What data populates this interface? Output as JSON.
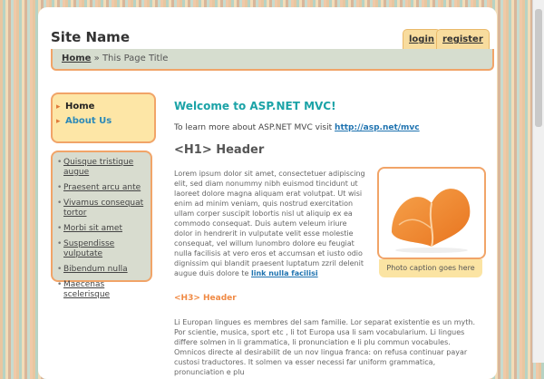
{
  "header": {
    "site_name": "Site Name",
    "login_label": "login",
    "register_label": "register"
  },
  "breadcrumb": {
    "home": "Home",
    "separator": "»",
    "current": "This Page Title"
  },
  "nav": {
    "items": [
      {
        "label": "Home"
      },
      {
        "label": "About Us"
      }
    ]
  },
  "sidebar_links": [
    "Quisque tristique augue",
    "Praesent arcu ante",
    "Vivamus consequat tortor",
    "Morbi sit amet",
    "Suspendisse vulputate",
    "Bibendum nulla",
    "Maecenas scelerisque"
  ],
  "main": {
    "welcome": "Welcome to ASP.NET MVC!",
    "intro_text": "To learn more about ASP.NET MVC visit",
    "intro_url": "http://asp.net/mvc",
    "h1": "<H1> Header",
    "lorem": "Lorem ipsum dolor sit amet, consectetuer adipiscing elit, sed diam nonummy nibh euismod tincidunt ut laoreet dolore magna aliquam erat volutpat. Ut wisi enim ad minim veniam, quis nostrud exercitation ullam corper suscipit lobortis nisl ut aliquip ex ea commodo consequat. Duis autem veleum iriure dolor in hendrerit in vulputate velit esse molestie consequat, vel willum lunombro dolore eu feugiat nulla facilisis at vero eros et accumsan et iusto odio dignissim qui blandit praesent luptatum zzril delenit augue duis dolore te",
    "lorem_link": "link nulla facilisi",
    "photo_caption": "Photo caption goes here",
    "h3": "<H3> Header",
    "body2": "Li Europan lingues es membres del sam familie. Lor separat existentie es un myth. Por scientie, musica, sport etc , li tot Europa usa li sam vocabularium. Li lingues differe solmen in li grammatica, li pronunciation e li plu commun vocabules. Omnicos directe al desirabilit de un nov lingua franca: on refusa continuar payar custosi traductores. It solmen va esser necessi far uniform grammatica, pronunciation e plu"
  },
  "colors": {
    "accent_teal": "#1ba3a7",
    "accent_orange": "#f1a468",
    "tab_yellow": "#f8dc9e",
    "link_blue": "#1f73b0"
  },
  "icons": {
    "nav_bullet": "triangle-right-icon",
    "photo": "orange-heart-ribbon-image"
  }
}
